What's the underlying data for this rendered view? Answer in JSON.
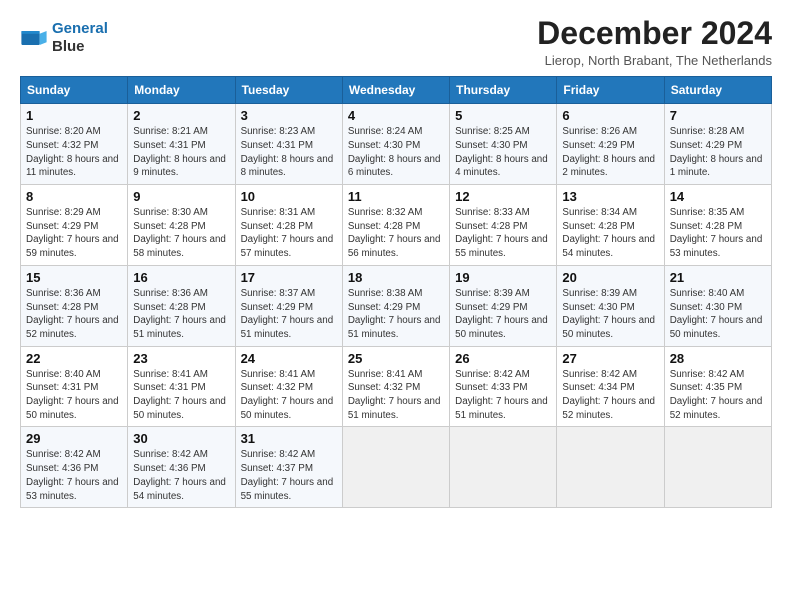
{
  "logo": {
    "line1": "General",
    "line2": "Blue"
  },
  "title": "December 2024",
  "subtitle": "Lierop, North Brabant, The Netherlands",
  "weekdays": [
    "Sunday",
    "Monday",
    "Tuesday",
    "Wednesday",
    "Thursday",
    "Friday",
    "Saturday"
  ],
  "weeks": [
    [
      {
        "day": "1",
        "sunrise": "Sunrise: 8:20 AM",
        "sunset": "Sunset: 4:32 PM",
        "daylight": "Daylight: 8 hours and 11 minutes."
      },
      {
        "day": "2",
        "sunrise": "Sunrise: 8:21 AM",
        "sunset": "Sunset: 4:31 PM",
        "daylight": "Daylight: 8 hours and 9 minutes."
      },
      {
        "day": "3",
        "sunrise": "Sunrise: 8:23 AM",
        "sunset": "Sunset: 4:31 PM",
        "daylight": "Daylight: 8 hours and 8 minutes."
      },
      {
        "day": "4",
        "sunrise": "Sunrise: 8:24 AM",
        "sunset": "Sunset: 4:30 PM",
        "daylight": "Daylight: 8 hours and 6 minutes."
      },
      {
        "day": "5",
        "sunrise": "Sunrise: 8:25 AM",
        "sunset": "Sunset: 4:30 PM",
        "daylight": "Daylight: 8 hours and 4 minutes."
      },
      {
        "day": "6",
        "sunrise": "Sunrise: 8:26 AM",
        "sunset": "Sunset: 4:29 PM",
        "daylight": "Daylight: 8 hours and 2 minutes."
      },
      {
        "day": "7",
        "sunrise": "Sunrise: 8:28 AM",
        "sunset": "Sunset: 4:29 PM",
        "daylight": "Daylight: 8 hours and 1 minute."
      }
    ],
    [
      {
        "day": "8",
        "sunrise": "Sunrise: 8:29 AM",
        "sunset": "Sunset: 4:29 PM",
        "daylight": "Daylight: 7 hours and 59 minutes."
      },
      {
        "day": "9",
        "sunrise": "Sunrise: 8:30 AM",
        "sunset": "Sunset: 4:28 PM",
        "daylight": "Daylight: 7 hours and 58 minutes."
      },
      {
        "day": "10",
        "sunrise": "Sunrise: 8:31 AM",
        "sunset": "Sunset: 4:28 PM",
        "daylight": "Daylight: 7 hours and 57 minutes."
      },
      {
        "day": "11",
        "sunrise": "Sunrise: 8:32 AM",
        "sunset": "Sunset: 4:28 PM",
        "daylight": "Daylight: 7 hours and 56 minutes."
      },
      {
        "day": "12",
        "sunrise": "Sunrise: 8:33 AM",
        "sunset": "Sunset: 4:28 PM",
        "daylight": "Daylight: 7 hours and 55 minutes."
      },
      {
        "day": "13",
        "sunrise": "Sunrise: 8:34 AM",
        "sunset": "Sunset: 4:28 PM",
        "daylight": "Daylight: 7 hours and 54 minutes."
      },
      {
        "day": "14",
        "sunrise": "Sunrise: 8:35 AM",
        "sunset": "Sunset: 4:28 PM",
        "daylight": "Daylight: 7 hours and 53 minutes."
      }
    ],
    [
      {
        "day": "15",
        "sunrise": "Sunrise: 8:36 AM",
        "sunset": "Sunset: 4:28 PM",
        "daylight": "Daylight: 7 hours and 52 minutes."
      },
      {
        "day": "16",
        "sunrise": "Sunrise: 8:36 AM",
        "sunset": "Sunset: 4:28 PM",
        "daylight": "Daylight: 7 hours and 51 minutes."
      },
      {
        "day": "17",
        "sunrise": "Sunrise: 8:37 AM",
        "sunset": "Sunset: 4:29 PM",
        "daylight": "Daylight: 7 hours and 51 minutes."
      },
      {
        "day": "18",
        "sunrise": "Sunrise: 8:38 AM",
        "sunset": "Sunset: 4:29 PM",
        "daylight": "Daylight: 7 hours and 51 minutes."
      },
      {
        "day": "19",
        "sunrise": "Sunrise: 8:39 AM",
        "sunset": "Sunset: 4:29 PM",
        "daylight": "Daylight: 7 hours and 50 minutes."
      },
      {
        "day": "20",
        "sunrise": "Sunrise: 8:39 AM",
        "sunset": "Sunset: 4:30 PM",
        "daylight": "Daylight: 7 hours and 50 minutes."
      },
      {
        "day": "21",
        "sunrise": "Sunrise: 8:40 AM",
        "sunset": "Sunset: 4:30 PM",
        "daylight": "Daylight: 7 hours and 50 minutes."
      }
    ],
    [
      {
        "day": "22",
        "sunrise": "Sunrise: 8:40 AM",
        "sunset": "Sunset: 4:31 PM",
        "daylight": "Daylight: 7 hours and 50 minutes."
      },
      {
        "day": "23",
        "sunrise": "Sunrise: 8:41 AM",
        "sunset": "Sunset: 4:31 PM",
        "daylight": "Daylight: 7 hours and 50 minutes."
      },
      {
        "day": "24",
        "sunrise": "Sunrise: 8:41 AM",
        "sunset": "Sunset: 4:32 PM",
        "daylight": "Daylight: 7 hours and 50 minutes."
      },
      {
        "day": "25",
        "sunrise": "Sunrise: 8:41 AM",
        "sunset": "Sunset: 4:32 PM",
        "daylight": "Daylight: 7 hours and 51 minutes."
      },
      {
        "day": "26",
        "sunrise": "Sunrise: 8:42 AM",
        "sunset": "Sunset: 4:33 PM",
        "daylight": "Daylight: 7 hours and 51 minutes."
      },
      {
        "day": "27",
        "sunrise": "Sunrise: 8:42 AM",
        "sunset": "Sunset: 4:34 PM",
        "daylight": "Daylight: 7 hours and 52 minutes."
      },
      {
        "day": "28",
        "sunrise": "Sunrise: 8:42 AM",
        "sunset": "Sunset: 4:35 PM",
        "daylight": "Daylight: 7 hours and 52 minutes."
      }
    ],
    [
      {
        "day": "29",
        "sunrise": "Sunrise: 8:42 AM",
        "sunset": "Sunset: 4:36 PM",
        "daylight": "Daylight: 7 hours and 53 minutes."
      },
      {
        "day": "30",
        "sunrise": "Sunrise: 8:42 AM",
        "sunset": "Sunset: 4:36 PM",
        "daylight": "Daylight: 7 hours and 54 minutes."
      },
      {
        "day": "31",
        "sunrise": "Sunrise: 8:42 AM",
        "sunset": "Sunset: 4:37 PM",
        "daylight": "Daylight: 7 hours and 55 minutes."
      },
      null,
      null,
      null,
      null
    ]
  ]
}
